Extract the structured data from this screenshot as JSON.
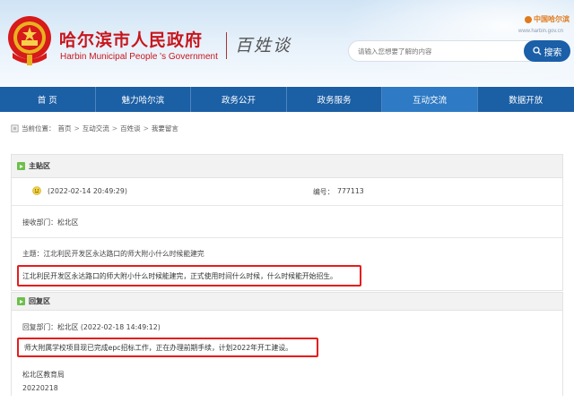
{
  "header": {
    "site_title": "哈尔滨市人民政府",
    "site_subtitle": "Harbin Municipal People 's Government",
    "section_title": "百姓谈",
    "brand_logo": "中国哈尔滨",
    "site_url": "www.harbin.gov.cn",
    "search": {
      "placeholder": "请输入您想要了解的内容",
      "button_label": "搜索"
    }
  },
  "nav": {
    "items": [
      {
        "label": "首 页"
      },
      {
        "label": "魅力哈尔滨"
      },
      {
        "label": "政务公开"
      },
      {
        "label": "政务服务"
      },
      {
        "label": "互动交流",
        "active": true
      },
      {
        "label": "数据开放"
      }
    ]
  },
  "breadcrumb": {
    "prefix": "当前位置：",
    "items": [
      "首页",
      "互动交流",
      "百姓谈",
      "我要留言"
    ],
    "separator": ">"
  },
  "main_topic": {
    "heading": "主贴区",
    "datetime": "(2022-02-14 20:49:29)",
    "number_label": "编号：",
    "number": "777113",
    "receiver": "接收部门：松北区",
    "subject": "主题：江北利民开发区永达路口的师大附小什么时候能建完",
    "content": "江北利民开发区永达路口的师大附小什么时候能建完，正式使用时间什么时候，什么时候能开始招生。"
  },
  "reply": {
    "heading": "回复区",
    "dept_time": "回复部门：松北区 (2022-02-18 14:49:12)",
    "content": "师大附属学校项目现已完成epc招标工作，正在办理前期手续，计划2022年开工建设。",
    "signature": "松北区教育局",
    "date": "20220218"
  },
  "colors": {
    "brand_red": "#c8161d",
    "nav_blue": "#1b5fa5",
    "highlight_red": "#e51c1c",
    "section_green": "#6cc04a"
  },
  "icons": [
    "emblem-icon",
    "search-icon",
    "location-icon",
    "arrow-right-icon",
    "smiley-icon",
    "globe-icon"
  ]
}
